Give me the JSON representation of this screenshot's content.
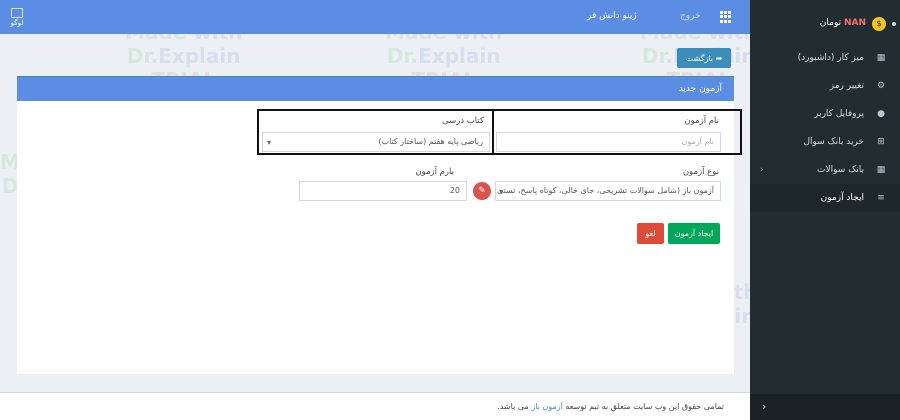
{
  "header": {
    "logo_text": "لوگو",
    "app_title": "ژینو دانش فر",
    "logout": "خروج"
  },
  "sidebar": {
    "user_currency": "تومان",
    "user_balance": "NAN",
    "items": [
      {
        "label": "میز کار (داشبورد)",
        "icon": "dashboard-grid-icon"
      },
      {
        "label": "تغییر رمز",
        "icon": "gear-icon"
      },
      {
        "label": "پروفایل کاربر",
        "icon": "user-icon"
      },
      {
        "label": "خرید بانک سوال",
        "icon": "cart-icon"
      },
      {
        "label": "بانک سوالات",
        "icon": "grid-icon"
      },
      {
        "label": "ایجاد آزمون",
        "icon": "list-icon"
      }
    ]
  },
  "toolbar": {
    "back_label": "بازگشت"
  },
  "card": {
    "title": "آزمون جدید",
    "exam_name_label": "نام آزمون",
    "exam_name_placeholder": "نام آزمون",
    "textbook_label": "کتاب درسی",
    "textbook_value": "ریاضی پایه هفتم (ساختار کتاب)",
    "exam_type_label": "نوع آزمون",
    "exam_type_value": "آزمون باز (شامل سوالات تشریحی، جای خالی، کوتاه پاسخ، تستی)",
    "exam_score_label": "بارم آزمون",
    "exam_score_value": "20",
    "create_label": "ایجاد آزمون",
    "cancel_label": "لغو"
  },
  "footer": {
    "text_before": "تمامی حقوق این وب سایت متعلق به تیم توسعه",
    "brand": "آزمون باز",
    "text_after": "می باشد."
  },
  "watermark": {
    "line1a": "Made",
    "line1b": "with",
    "line2a": "Dr.",
    "line2b": "Explain",
    "line3": "TRIAL"
  },
  "colors": {
    "header": "#5b8de5",
    "sidebar": "#222d32",
    "primary": "#3c8dbc",
    "success": "#00a65a",
    "danger": "#dd4b39"
  }
}
